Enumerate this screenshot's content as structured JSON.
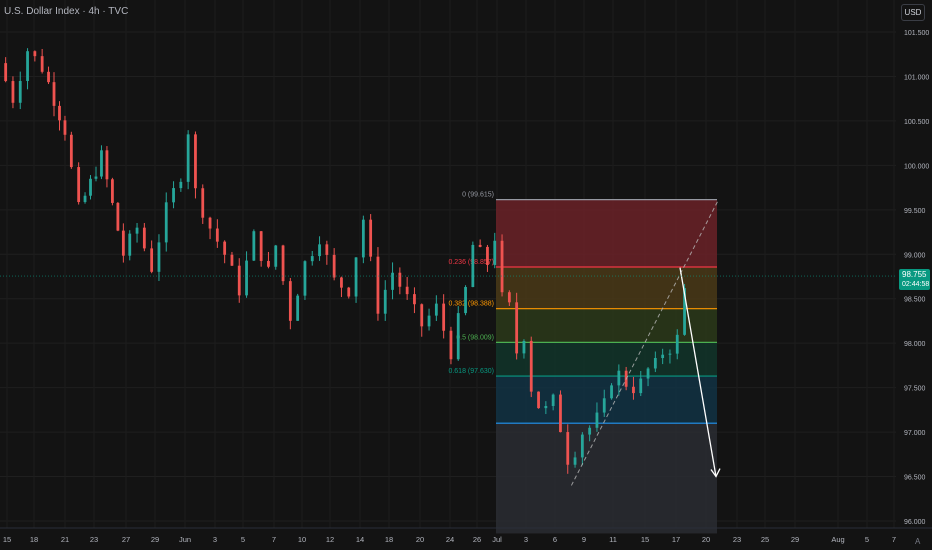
{
  "header": {
    "title": "U.S. Dollar Index · 4h · TVC",
    "currency": "USD"
  },
  "price_tag": {
    "price": "98.755",
    "countdown": "02:44:58",
    "color": "#089981"
  },
  "colors": {
    "background": "#131313",
    "up": "#26a69a",
    "down": "#ef5350",
    "axis_text": "#b2b5be"
  },
  "chart_data": {
    "type": "candlestick",
    "title": "U.S. Dollar Index",
    "interval": "4h",
    "source": "TVC",
    "y_axis": {
      "side": "right",
      "ylim": [
        95.95,
        101.8
      ],
      "tick_labels": [
        "101.500",
        "101.000",
        "100.500",
        "100.000",
        "99.500",
        "99.000",
        "98.500",
        "98.000",
        "97.500",
        "97.000",
        "96.500",
        "96.000"
      ]
    },
    "x_axis": {
      "tick_labels": [
        "15",
        "18",
        "21",
        "23",
        "27",
        "29",
        "Jun",
        "3",
        "5",
        "7",
        "10",
        "12",
        "14",
        "18",
        "20",
        "24",
        "26",
        "Jul",
        "3",
        "6",
        "9",
        "11",
        "15",
        "17",
        "20",
        "23",
        "25",
        "29",
        "Aug",
        "5",
        "7"
      ]
    },
    "price_path": [
      [
        0,
        101.15
      ],
      [
        2,
        100.75
      ],
      [
        4,
        101.3
      ],
      [
        6,
        101.1
      ],
      [
        9,
        100.4
      ],
      [
        11,
        99.5
      ],
      [
        14,
        100.1
      ],
      [
        17,
        99.0
      ],
      [
        19,
        99.3
      ],
      [
        21,
        98.85
      ],
      [
        23,
        99.5
      ],
      [
        25,
        99.9
      ],
      [
        26,
        100.4
      ],
      [
        27,
        99.7
      ],
      [
        29,
        99.3
      ],
      [
        31,
        99.0
      ],
      [
        33,
        98.6
      ],
      [
        35,
        99.2
      ],
      [
        37,
        98.8
      ],
      [
        38,
        99.1
      ],
      [
        40,
        98.3
      ],
      [
        42,
        98.9
      ],
      [
        44,
        99.2
      ],
      [
        46,
        98.7
      ],
      [
        48,
        98.6
      ],
      [
        50,
        99.4
      ],
      [
        52,
        98.4
      ],
      [
        54,
        98.8
      ],
      [
        56,
        98.5
      ],
      [
        58,
        98.2
      ],
      [
        60,
        98.4
      ],
      [
        62,
        97.9
      ],
      [
        64,
        98.6
      ],
      [
        65,
        99.1
      ],
      [
        67,
        98.9
      ],
      [
        68,
        99.2
      ],
      [
        69,
        98.5
      ],
      [
        70,
        98.4
      ],
      [
        71,
        97.9
      ],
      [
        72,
        98.1
      ],
      [
        73,
        97.5
      ],
      [
        74,
        97.3
      ],
      [
        75,
        97.25
      ],
      [
        76,
        97.35
      ],
      [
        77,
        97.05
      ],
      [
        78,
        96.7
      ],
      [
        79,
        96.8
      ],
      [
        80,
        97.0
      ],
      [
        81,
        97.05
      ],
      [
        82,
        97.15
      ],
      [
        83,
        97.3
      ],
      [
        84,
        97.6
      ],
      [
        85,
        97.65
      ],
      [
        86,
        97.55
      ],
      [
        87,
        97.5
      ],
      [
        88,
        97.55
      ],
      [
        89,
        97.7
      ],
      [
        90,
        97.75
      ],
      [
        91,
        97.9
      ],
      [
        92,
        97.95
      ],
      [
        93,
        98.05
      ],
      [
        94,
        98.6
      ],
      [
        95,
        98.4
      ],
      [
        96,
        98.5
      ],
      [
        97,
        98.7
      ]
    ],
    "fibonacci_retracement": [
      {
        "level": "0",
        "price": 99.615,
        "label": "0 (99.615)",
        "line_color": "#9598a1",
        "fill": "#6b2228"
      },
      {
        "level": "0.236",
        "price": 98.857,
        "label": "0.236 (98.857)",
        "line_color": "#f23645",
        "fill": "#4a3a18"
      },
      {
        "level": "0.382",
        "price": 98.388,
        "label": "0.382 (98.388)",
        "line_color": "#ff9800",
        "fill": "#2b3a1a"
      },
      {
        "level": "0.5",
        "price": 98.009,
        "label": "0.5 (98.009)",
        "line_color": "#4caf50",
        "fill": "#12352a"
      },
      {
        "level": "0.618",
        "price": 97.63,
        "label": "0.618 (97.630)",
        "line_color": "#089981",
        "fill": "#123344"
      },
      {
        "level": "0.786",
        "price": 97.1,
        "label": "",
        "line_color": "#2196f3",
        "fill": "#2a2d33"
      }
    ],
    "fib_bottom_price": 95.95,
    "trend_line": {
      "from": [
        78,
        96.4
      ],
      "to": [
        98,
        99.59
      ],
      "style": "dashed"
    },
    "projection_arrow": {
      "from": [
        98.4,
        98.85
      ],
      "to": [
        100.7,
        96.5
      ]
    },
    "last_price": 98.755,
    "grid": true,
    "legend": "none"
  }
}
